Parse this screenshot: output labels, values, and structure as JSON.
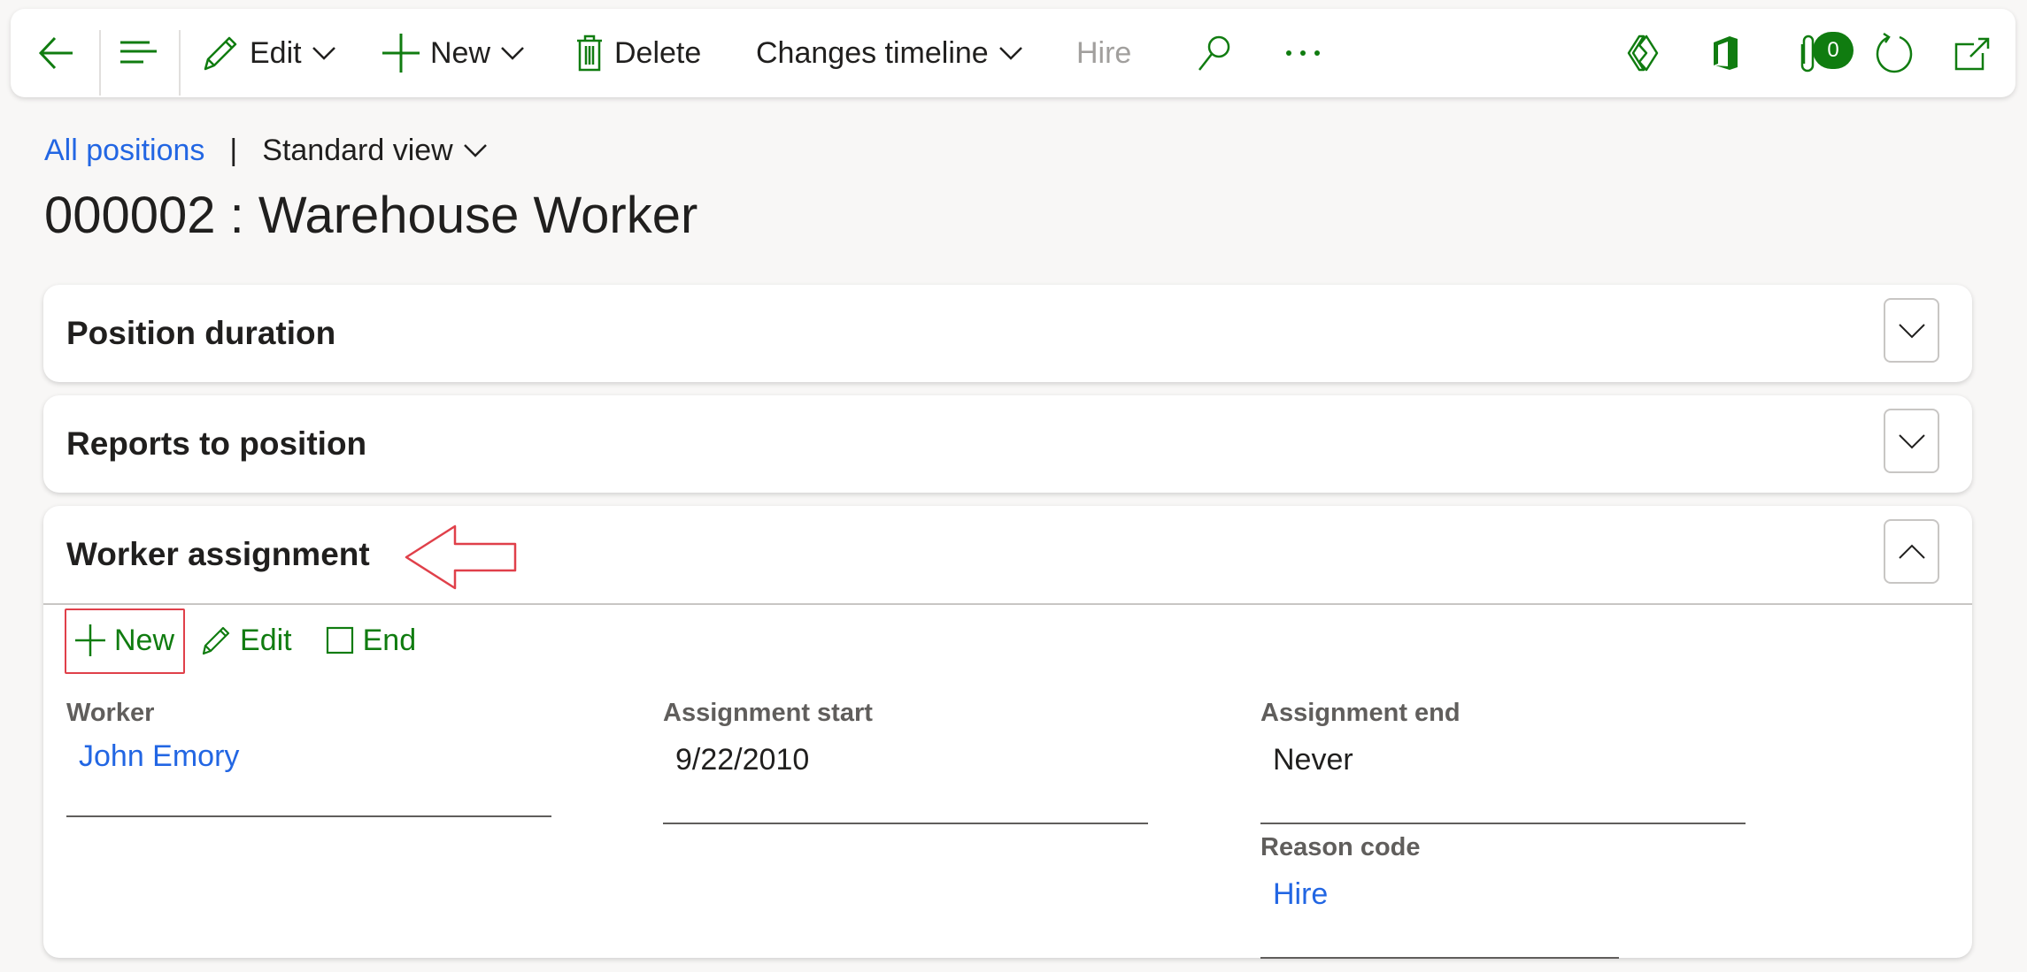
{
  "toolbar": {
    "back_icon": "arrow-left-icon",
    "menu_icon": "lines-icon",
    "edit": {
      "label": "Edit",
      "icon": "pencil-icon"
    },
    "new": {
      "label": "New",
      "icon": "plus-icon"
    },
    "delete": {
      "label": "Delete",
      "icon": "trash-icon"
    },
    "changes_timeline": {
      "label": "Changes timeline"
    },
    "hire": {
      "label": "Hire",
      "disabled": true
    },
    "search_icon": "search-icon",
    "more_icon": "ellipsis-icon",
    "right_icons": [
      "power-apps-icon",
      "office-icon",
      "attachment-icon",
      "refresh-icon",
      "open-new-window-icon"
    ],
    "attachment_count": "0"
  },
  "breadcrumb": {
    "link": "All positions",
    "separator": "|",
    "view": "Standard view"
  },
  "page_title": "000002 : Warehouse Worker",
  "sections": [
    {
      "title": "Position duration",
      "expanded": false
    },
    {
      "title": "Reports to position",
      "expanded": false
    },
    {
      "title": "Worker assignment",
      "expanded": true
    }
  ],
  "worker_assignment": {
    "actions": [
      {
        "label": "New",
        "icon": "plus-icon"
      },
      {
        "label": "Edit",
        "icon": "pencil-icon"
      },
      {
        "label": "End",
        "icon": "square-icon"
      }
    ],
    "fields": {
      "worker": {
        "label": "Worker",
        "value": "John Emory"
      },
      "assignment_start": {
        "label": "Assignment start",
        "value": "9/22/2010"
      },
      "assignment_end": {
        "label": "Assignment end",
        "value": "Never"
      },
      "reason_code": {
        "label": "Reason code",
        "value": "Hire"
      }
    }
  },
  "colors": {
    "accent_green": "#107c10",
    "link_blue": "#2266e3",
    "annotation_red": "#e0404a"
  }
}
